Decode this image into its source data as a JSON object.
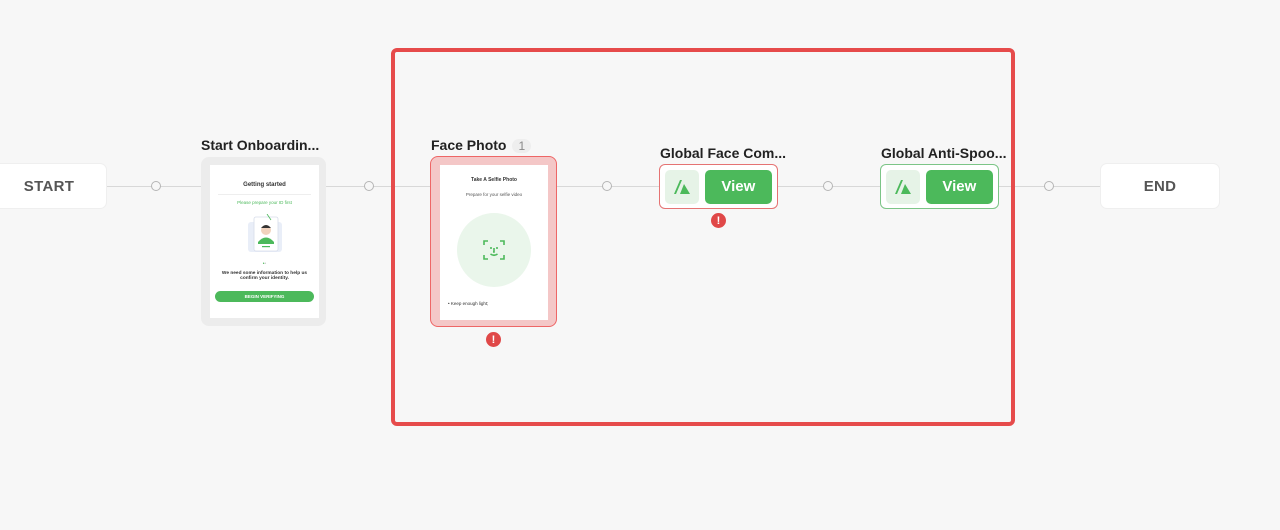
{
  "flow": {
    "start_label": "START",
    "end_label": "END"
  },
  "steps": {
    "onboarding": {
      "title": "Start Onboardin...",
      "preview": {
        "heading": "Getting started",
        "subheading": "Please prepare your ID first",
        "body_line1": "We need some information to help us",
        "body_line2": "confirm your identity.",
        "button_label": "BEGIN VERIFYING"
      }
    },
    "face_photo": {
      "title": "Face Photo",
      "count": "1",
      "preview": {
        "heading": "Take A Selfie Photo",
        "subheading": "Prepare for your selfie video",
        "bullet1": "Keep enough light;"
      },
      "error_icon": "!"
    },
    "face_compare": {
      "title": "Global Face Com...",
      "button_label": "View",
      "error_icon": "!"
    },
    "anti_spoof": {
      "title": "Global Anti-Spoo...",
      "button_label": "View"
    }
  },
  "colors": {
    "accent": "#4cb95b",
    "error": "#e04848",
    "selection": "#e64b4b",
    "background": "#f7f7f7"
  }
}
